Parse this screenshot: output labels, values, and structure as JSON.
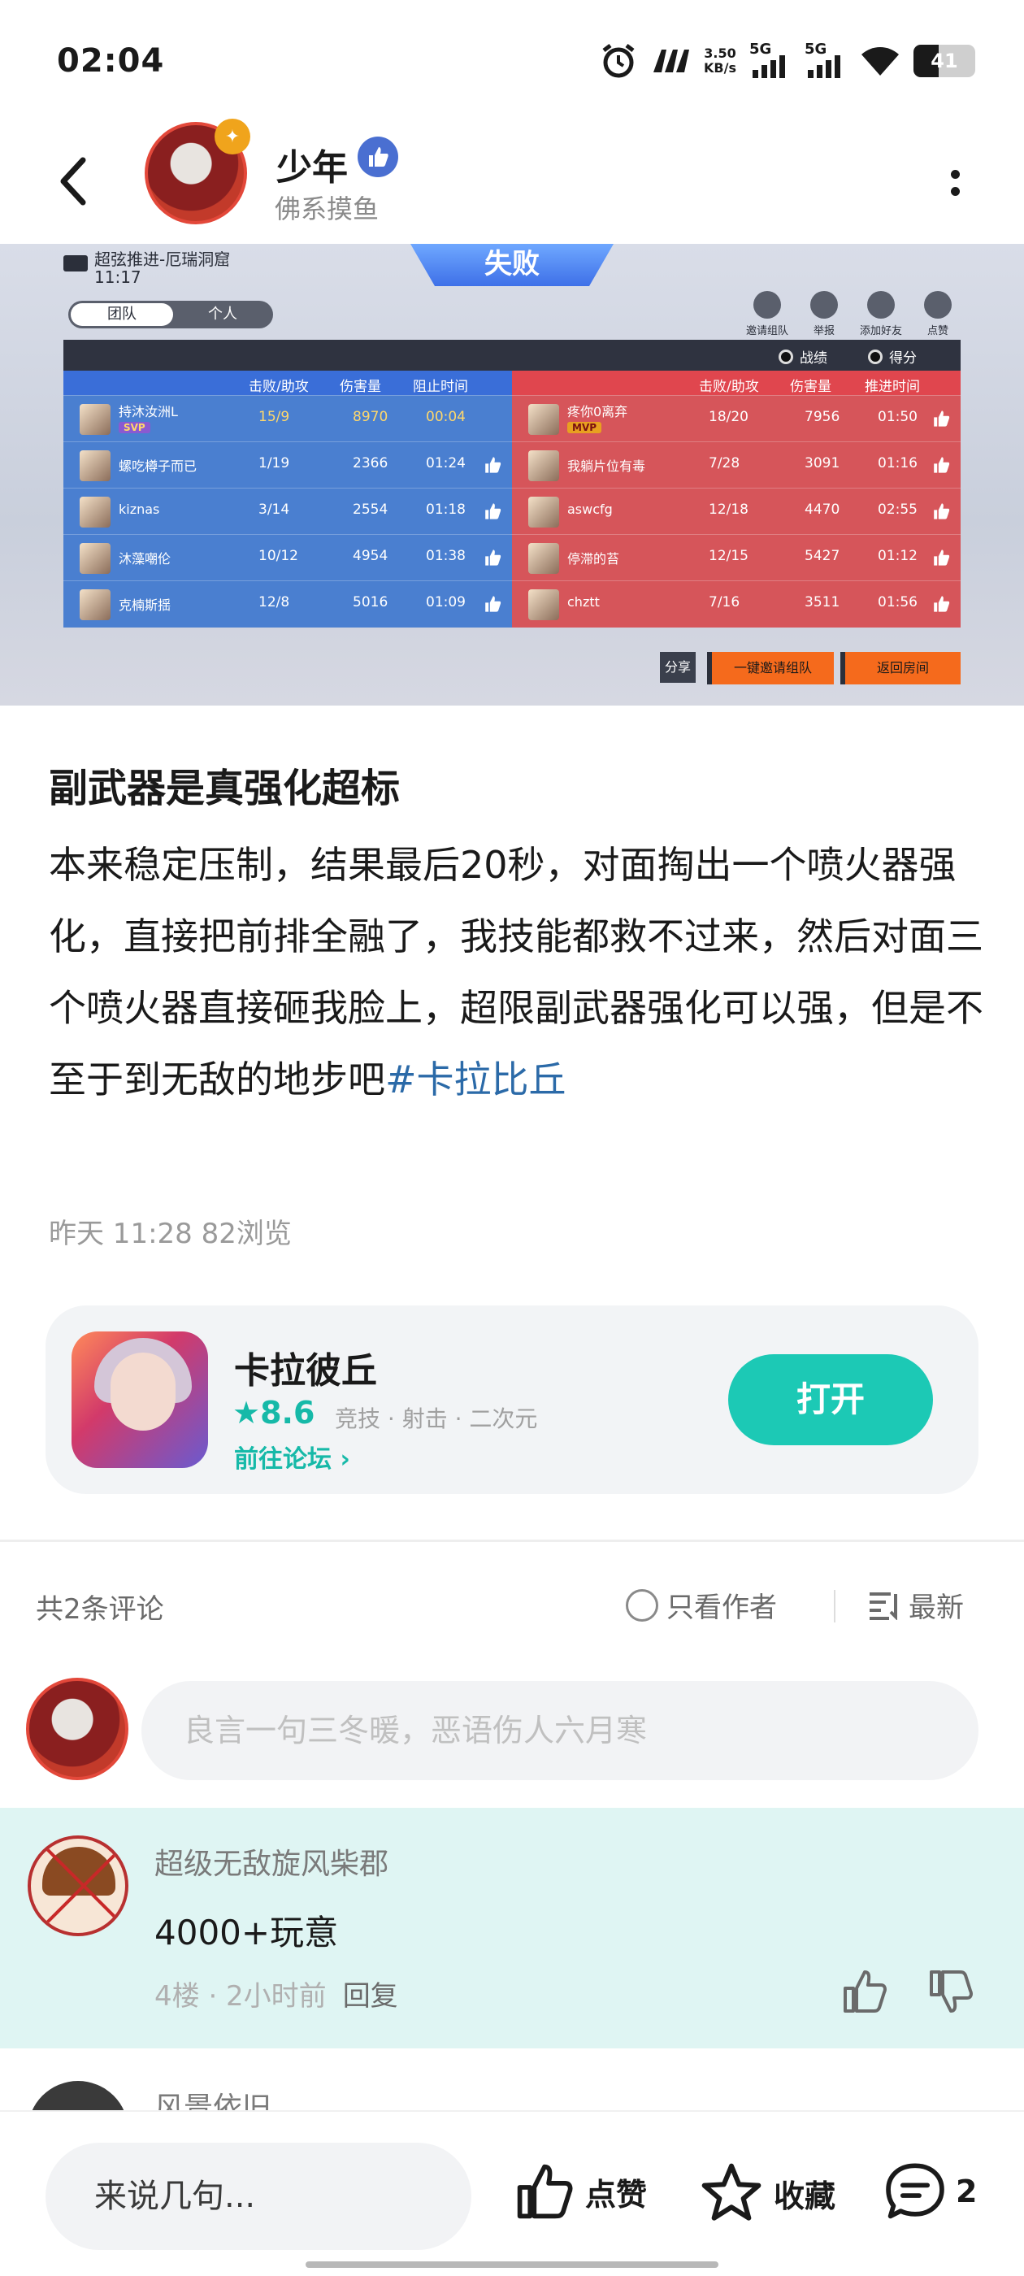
{
  "status_bar": {
    "time": "02:04",
    "net_speed": "3.50",
    "net_unit": "KB/s",
    "net1": "5G",
    "net2": "5G",
    "battery": "41",
    "battery_level": 0.41
  },
  "header": {
    "username": "少年",
    "subtitle": "佛系摸鱼"
  },
  "game_screenshot": {
    "mode": "超弦推进-厄瑞洞窟",
    "time": "11:17",
    "result": "失败",
    "tabs": [
      "团队",
      "个人"
    ],
    "actions": [
      "邀请组队",
      "举报",
      "添加好友",
      "点赞"
    ],
    "view_options": [
      "战绩",
      "得分"
    ],
    "blue_headers": [
      "击败/助攻",
      "伤害量",
      "阻止时间"
    ],
    "red_headers": [
      "击败/助攻",
      "伤害量",
      "推进时间"
    ],
    "blue_team": [
      {
        "name": "持沐汝洲L",
        "tag": "SVP",
        "kd": "15/9",
        "dmg": "8970",
        "time": "00:04"
      },
      {
        "name": "螺吃樽子而已",
        "tag": "",
        "kd": "1/19",
        "dmg": "2366",
        "time": "01:24"
      },
      {
        "name": "kiznas",
        "tag": "",
        "kd": "3/14",
        "dmg": "2554",
        "time": "01:18"
      },
      {
        "name": "沐藻嘲伦",
        "tag": "",
        "kd": "10/12",
        "dmg": "4954",
        "time": "01:38"
      },
      {
        "name": "克楠斯揺",
        "tag": "",
        "kd": "12/8",
        "dmg": "5016",
        "time": "01:09"
      }
    ],
    "red_team": [
      {
        "name": "疼你0离弃",
        "tag": "MVP",
        "kd": "18/20",
        "dmg": "7956",
        "time": "01:50"
      },
      {
        "name": "我躺片位有毒",
        "tag": "",
        "kd": "7/28",
        "dmg": "3091",
        "time": "01:16"
      },
      {
        "name": "aswcfg",
        "tag": "",
        "kd": "12/18",
        "dmg": "4470",
        "time": "02:55"
      },
      {
        "name": "停滞的苔",
        "tag": "",
        "kd": "12/15",
        "dmg": "5427",
        "time": "01:12"
      },
      {
        "name": "chztt",
        "tag": "",
        "kd": "7/16",
        "dmg": "3511",
        "time": "01:56"
      }
    ],
    "buttons": {
      "share": "分享",
      "invite": "一键邀请组队",
      "return": "返回房间"
    }
  },
  "post": {
    "title": "副武器是真强化超标",
    "body": "本来稳定压制，结果最后20秒，对面掏出一个喷火器强化，直接把前排全融了，我技能都救不过来，然后对面三个喷火器直接砸我脸上，超限副武器强化可以强，但是不至于到无敌的地步吧",
    "hashtag": "#卡拉比丘",
    "meta": "昨天 11:28  82浏览"
  },
  "app_card": {
    "name": "卡拉彼丘",
    "rating": "8.6",
    "tags": "竞技 · 射击 · 二次元",
    "forum": "前往论坛",
    "open": "打开"
  },
  "comments": {
    "count": "共2条评论",
    "author_only": "只看作者",
    "sort": "最新",
    "input_placeholder": "良言一句三冬暖，恶语伤人六月寒",
    "items": [
      {
        "user": "超级无敌旋风柴郡",
        "text": "4000+玩意",
        "meta": "4楼 · 2小时前",
        "reply": "回复"
      },
      {
        "user": "风景依旧"
      }
    ]
  },
  "bottom_bar": {
    "input": "来说几句...",
    "like": "点赞",
    "fav": "收藏",
    "comments": "2"
  },
  "colors": {
    "accent": "#1cc9b5",
    "hashtag": "#2b6aa8",
    "comment_bg": "#dff5f3"
  }
}
